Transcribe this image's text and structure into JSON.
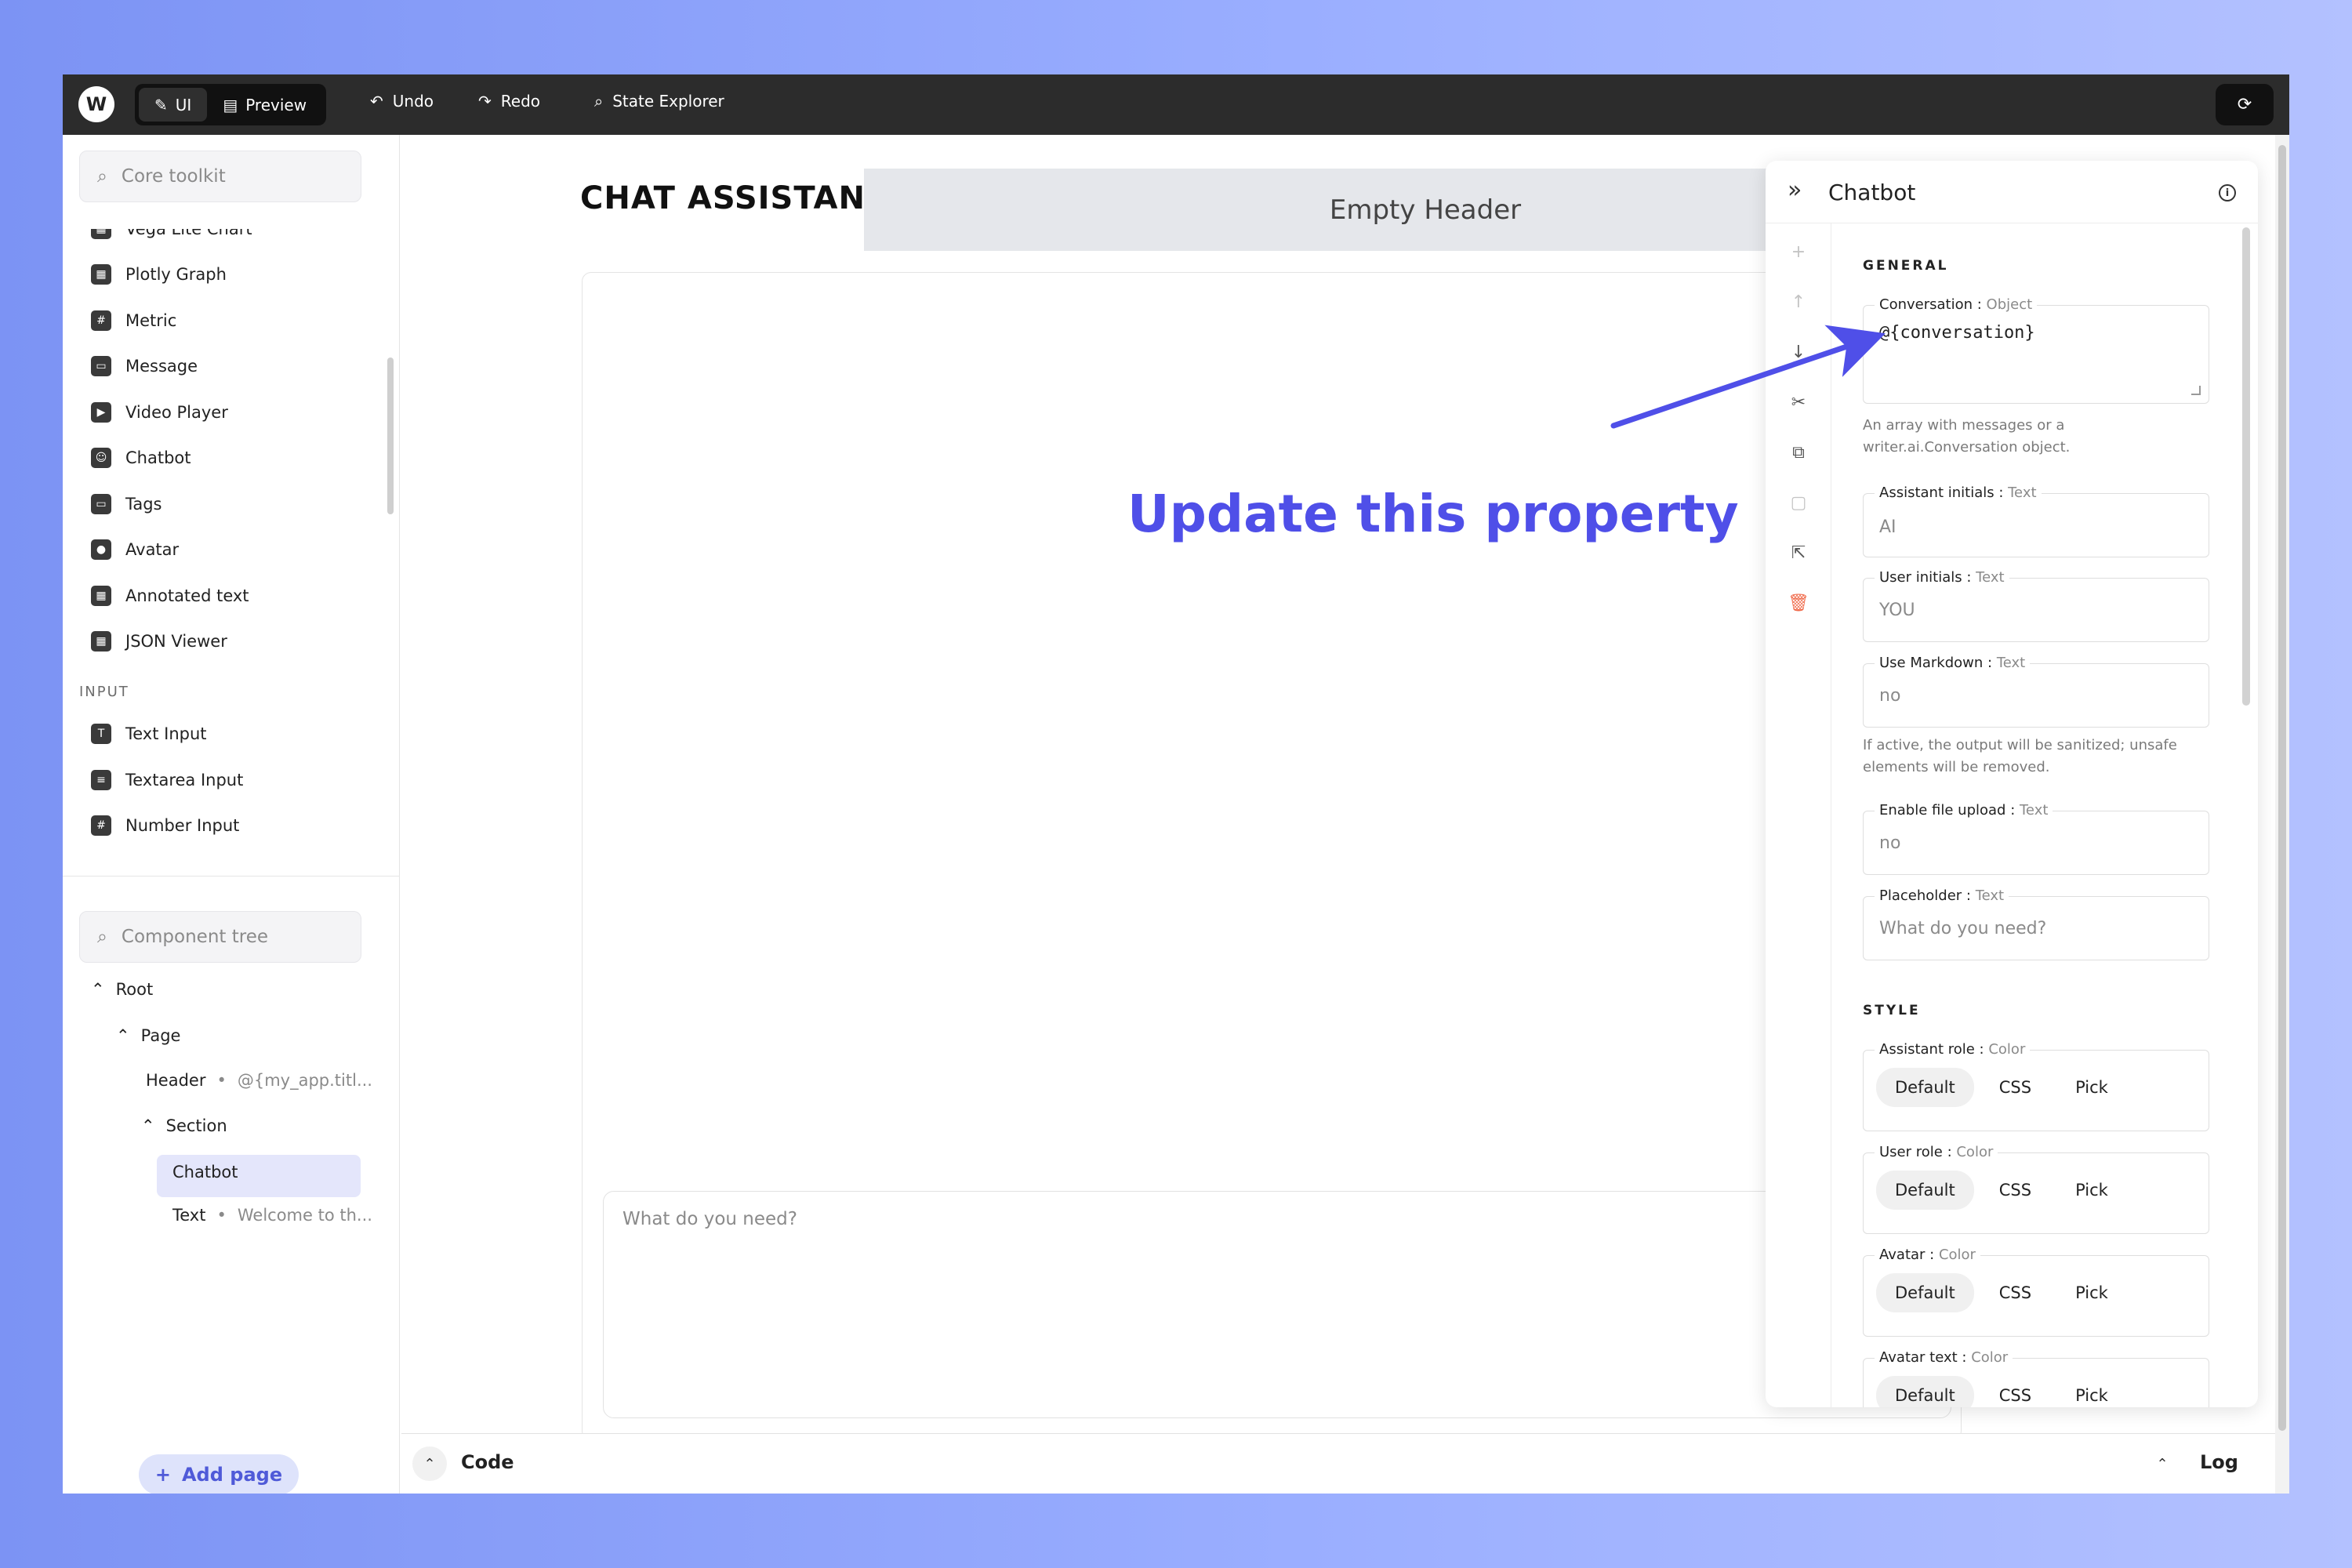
{
  "topbar": {
    "logo": "W",
    "modes": [
      {
        "label": "UI",
        "icon": "pencil-icon",
        "active": true
      },
      {
        "label": "Preview",
        "icon": "preview-icon",
        "active": false
      }
    ],
    "undo": "Undo",
    "redo": "Redo",
    "state_explorer": "State Explorer"
  },
  "toolkit": {
    "search_placeholder": "Core toolkit",
    "cut_item": "Vega Lite Chart",
    "items": [
      "Plotly Graph",
      "Metric",
      "Message",
      "Video Player",
      "Chatbot",
      "Tags",
      "Avatar",
      "Annotated text",
      "JSON Viewer"
    ],
    "input_category": "INPUT",
    "input_items": [
      "Text Input",
      "Textarea Input",
      "Number Input"
    ]
  },
  "tree": {
    "search_placeholder": "Component tree",
    "root": "Root",
    "page": "Page",
    "header": "Header",
    "header_hint": "@{my_app.titl...",
    "section": "Section",
    "chatbot": "Chatbot",
    "text": "Text",
    "text_hint": "Welcome to th..."
  },
  "add_page": "Add page",
  "canvas": {
    "app_title": "CHAT ASSISTANT",
    "empty_header": "Empty Header",
    "chat_placeholder": "What do you need?",
    "annotation": "Update this property"
  },
  "bottombar": {
    "code": "Code",
    "log": "Log"
  },
  "panel": {
    "title": "Chatbot",
    "general_label": "GENERAL",
    "style_label": "STYLE",
    "fields": {
      "conversation": {
        "label": "Conversation",
        "type": "Object",
        "value": "@{conversation}",
        "help": "An array with messages or a writer.ai.Conversation object."
      },
      "assistant_initials": {
        "label": "Assistant initials",
        "type": "Text",
        "value": "AI"
      },
      "user_initials": {
        "label": "User initials",
        "type": "Text",
        "value": "YOU"
      },
      "use_markdown": {
        "label": "Use Markdown",
        "type": "Text",
        "value": "no",
        "help": "If active, the output will be sanitized; unsafe elements will be removed."
      },
      "file_upload": {
        "label": "Enable file upload",
        "type": "Text",
        "value": "no"
      },
      "placeholder": {
        "label": "Placeholder",
        "type": "Text",
        "value": "What do you need?"
      }
    },
    "style_fields": [
      {
        "label": "Assistant role",
        "type": "Color"
      },
      {
        "label": "User role",
        "type": "Color"
      },
      {
        "label": "Avatar",
        "type": "Color"
      },
      {
        "label": "Avatar text",
        "type": "Color"
      }
    ],
    "color_options": [
      "Default",
      "CSS",
      "Pick"
    ]
  },
  "colors": {
    "accent": "#4f4fe8",
    "topbar": "#2c2c2c",
    "selected": "#e4e6fb",
    "danger": "#f06a4a"
  }
}
